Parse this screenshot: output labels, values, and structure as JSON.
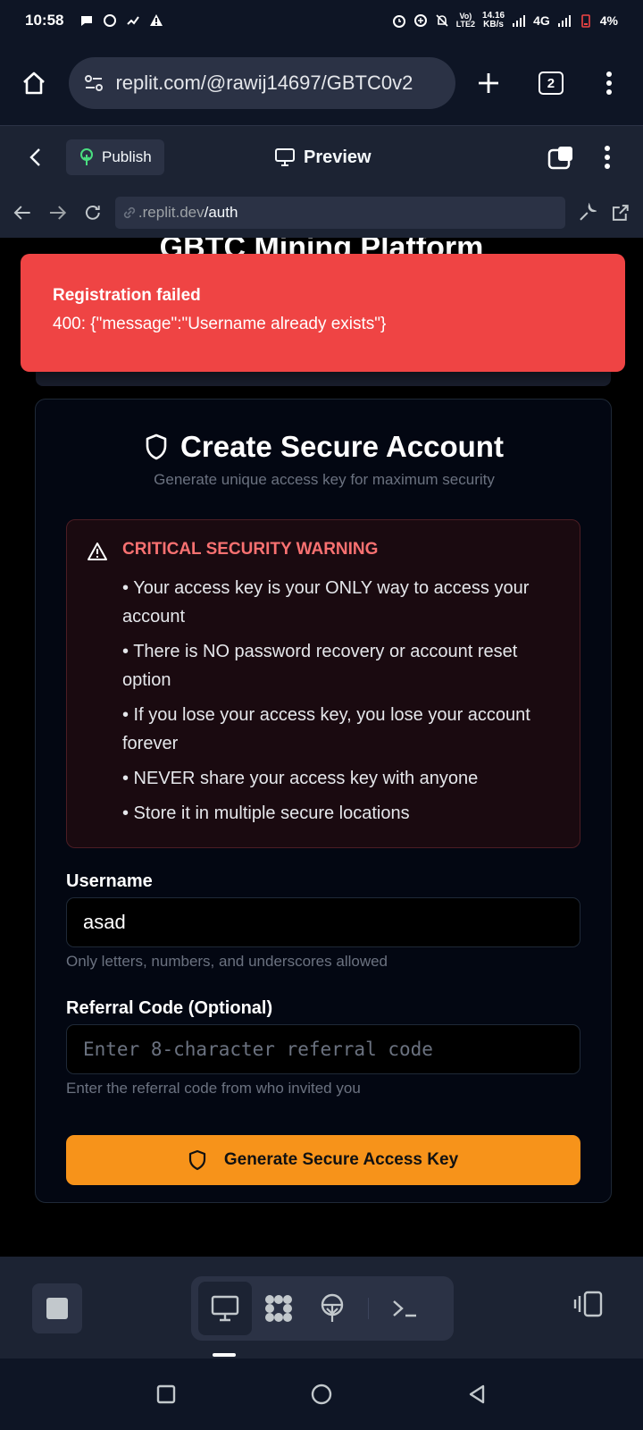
{
  "status_bar": {
    "time": "10:58",
    "net_speed": "14.16",
    "net_unit": "KB/s",
    "network": "4G",
    "battery": "4%"
  },
  "browser": {
    "url": "replit.com/@rawij14697/GBTC0v2",
    "tab_count": "2"
  },
  "replit_bar": {
    "publish_label": "Publish",
    "preview_label": "Preview"
  },
  "webview": {
    "address_prefix": ".replit.dev",
    "address_path": "/auth"
  },
  "page": {
    "platform_title": "GBTC Mining Platform"
  },
  "toast": {
    "title": "Registration failed",
    "message": "400: {\"message\":\"Username already exists\"}"
  },
  "card": {
    "title": "Create Secure Account",
    "subtitle": "Generate unique access key for maximum security",
    "warning": {
      "title": "CRITICAL SECURITY WARNING",
      "items": [
        "• Your access key is your ONLY way to access your account",
        "• There is NO password recovery or account reset option",
        "• If you lose your access key, you lose your account forever",
        "• NEVER share your access key with anyone",
        "• Store it in multiple secure locations"
      ]
    },
    "username": {
      "label": "Username",
      "value": "asad",
      "hint": "Only letters, numbers, and underscores allowed"
    },
    "referral": {
      "label": "Referral Code (Optional)",
      "placeholder": "Enter 8-character referral code",
      "hint": "Enter the referral code from who invited you"
    },
    "submit_label": "Generate Secure Access Key"
  },
  "colors": {
    "accent": "#f7931a",
    "error": "#ef4444",
    "warning_text": "#f87171"
  }
}
